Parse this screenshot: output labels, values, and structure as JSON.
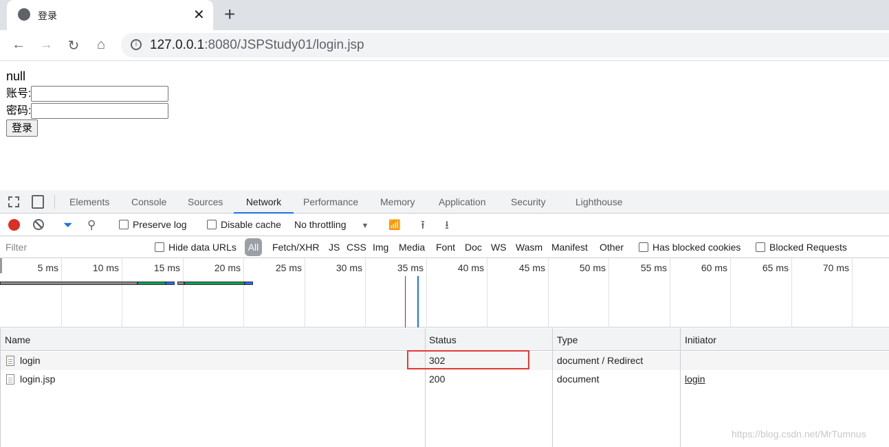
{
  "browser": {
    "tab_title": "登录",
    "url_host": "127.0.0.1",
    "url_rest": ":8080/JSPStudy01/login.jsp"
  },
  "page": {
    "message": "null",
    "account_label": "账号:",
    "password_label": "密码:",
    "account_value": "",
    "password_value": "",
    "submit_label": "登录"
  },
  "devtools": {
    "tabs": [
      "Elements",
      "Console",
      "Sources",
      "Network",
      "Performance",
      "Memory",
      "Application",
      "Security",
      "Lighthouse"
    ],
    "active_tab": "Network",
    "toolbar": {
      "preserve_log": "Preserve log",
      "disable_cache": "Disable cache",
      "throttling": "No throttling",
      "recording": true,
      "accent": "#1a73e8",
      "record_color": "#d93025"
    },
    "filter": {
      "placeholder": "Filter",
      "hide_data_urls": "Hide data URLs",
      "types": [
        "All",
        "Fetch/XHR",
        "JS",
        "CSS",
        "Img",
        "Media",
        "Font",
        "Doc",
        "WS",
        "Wasm",
        "Manifest",
        "Other"
      ],
      "active_type": "All",
      "has_blocked_cookies": "Has blocked cookies",
      "blocked_requests": "Blocked Requests"
    },
    "timeline_ticks": [
      "5 ms",
      "10 ms",
      "15 ms",
      "20 ms",
      "25 ms",
      "30 ms",
      "35 ms",
      "40 ms",
      "45 ms",
      "50 ms",
      "55 ms",
      "60 ms",
      "65 ms",
      "70 ms",
      "7"
    ],
    "columns": [
      "Name",
      "Status",
      "Type",
      "Initiator"
    ],
    "rows": [
      {
        "name": "login",
        "status": "302",
        "type": "document / Redirect",
        "initiator": ""
      },
      {
        "name": "login.jsp",
        "status": "200",
        "type": "document",
        "initiator": "login"
      }
    ],
    "highlight_color": "#e53935"
  },
  "watermark": "https://blog.csdn.net/MrTumnus"
}
